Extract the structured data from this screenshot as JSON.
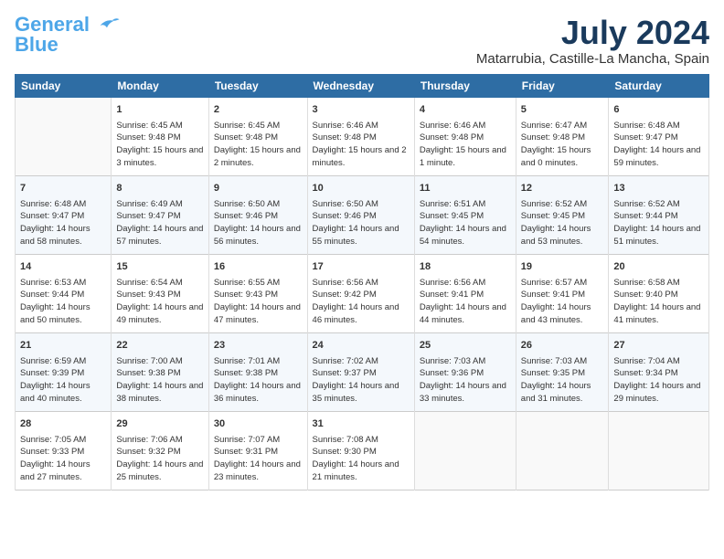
{
  "logo": {
    "line1": "General",
    "line2": "Blue"
  },
  "title": {
    "month_year": "July 2024",
    "location": "Matarrubia, Castille-La Mancha, Spain"
  },
  "days_of_week": [
    "Sunday",
    "Monday",
    "Tuesday",
    "Wednesday",
    "Thursday",
    "Friday",
    "Saturday"
  ],
  "weeks": [
    [
      {
        "day": "",
        "sunrise": "",
        "sunset": "",
        "daylight": ""
      },
      {
        "day": "1",
        "sunrise": "Sunrise: 6:45 AM",
        "sunset": "Sunset: 9:48 PM",
        "daylight": "Daylight: 15 hours and 3 minutes."
      },
      {
        "day": "2",
        "sunrise": "Sunrise: 6:45 AM",
        "sunset": "Sunset: 9:48 PM",
        "daylight": "Daylight: 15 hours and 2 minutes."
      },
      {
        "day": "3",
        "sunrise": "Sunrise: 6:46 AM",
        "sunset": "Sunset: 9:48 PM",
        "daylight": "Daylight: 15 hours and 2 minutes."
      },
      {
        "day": "4",
        "sunrise": "Sunrise: 6:46 AM",
        "sunset": "Sunset: 9:48 PM",
        "daylight": "Daylight: 15 hours and 1 minute."
      },
      {
        "day": "5",
        "sunrise": "Sunrise: 6:47 AM",
        "sunset": "Sunset: 9:48 PM",
        "daylight": "Daylight: 15 hours and 0 minutes."
      },
      {
        "day": "6",
        "sunrise": "Sunrise: 6:48 AM",
        "sunset": "Sunset: 9:47 PM",
        "daylight": "Daylight: 14 hours and 59 minutes."
      }
    ],
    [
      {
        "day": "7",
        "sunrise": "Sunrise: 6:48 AM",
        "sunset": "Sunset: 9:47 PM",
        "daylight": "Daylight: 14 hours and 58 minutes."
      },
      {
        "day": "8",
        "sunrise": "Sunrise: 6:49 AM",
        "sunset": "Sunset: 9:47 PM",
        "daylight": "Daylight: 14 hours and 57 minutes."
      },
      {
        "day": "9",
        "sunrise": "Sunrise: 6:50 AM",
        "sunset": "Sunset: 9:46 PM",
        "daylight": "Daylight: 14 hours and 56 minutes."
      },
      {
        "day": "10",
        "sunrise": "Sunrise: 6:50 AM",
        "sunset": "Sunset: 9:46 PM",
        "daylight": "Daylight: 14 hours and 55 minutes."
      },
      {
        "day": "11",
        "sunrise": "Sunrise: 6:51 AM",
        "sunset": "Sunset: 9:45 PM",
        "daylight": "Daylight: 14 hours and 54 minutes."
      },
      {
        "day": "12",
        "sunrise": "Sunrise: 6:52 AM",
        "sunset": "Sunset: 9:45 PM",
        "daylight": "Daylight: 14 hours and 53 minutes."
      },
      {
        "day": "13",
        "sunrise": "Sunrise: 6:52 AM",
        "sunset": "Sunset: 9:44 PM",
        "daylight": "Daylight: 14 hours and 51 minutes."
      }
    ],
    [
      {
        "day": "14",
        "sunrise": "Sunrise: 6:53 AM",
        "sunset": "Sunset: 9:44 PM",
        "daylight": "Daylight: 14 hours and 50 minutes."
      },
      {
        "day": "15",
        "sunrise": "Sunrise: 6:54 AM",
        "sunset": "Sunset: 9:43 PM",
        "daylight": "Daylight: 14 hours and 49 minutes."
      },
      {
        "day": "16",
        "sunrise": "Sunrise: 6:55 AM",
        "sunset": "Sunset: 9:43 PM",
        "daylight": "Daylight: 14 hours and 47 minutes."
      },
      {
        "day": "17",
        "sunrise": "Sunrise: 6:56 AM",
        "sunset": "Sunset: 9:42 PM",
        "daylight": "Daylight: 14 hours and 46 minutes."
      },
      {
        "day": "18",
        "sunrise": "Sunrise: 6:56 AM",
        "sunset": "Sunset: 9:41 PM",
        "daylight": "Daylight: 14 hours and 44 minutes."
      },
      {
        "day": "19",
        "sunrise": "Sunrise: 6:57 AM",
        "sunset": "Sunset: 9:41 PM",
        "daylight": "Daylight: 14 hours and 43 minutes."
      },
      {
        "day": "20",
        "sunrise": "Sunrise: 6:58 AM",
        "sunset": "Sunset: 9:40 PM",
        "daylight": "Daylight: 14 hours and 41 minutes."
      }
    ],
    [
      {
        "day": "21",
        "sunrise": "Sunrise: 6:59 AM",
        "sunset": "Sunset: 9:39 PM",
        "daylight": "Daylight: 14 hours and 40 minutes."
      },
      {
        "day": "22",
        "sunrise": "Sunrise: 7:00 AM",
        "sunset": "Sunset: 9:38 PM",
        "daylight": "Daylight: 14 hours and 38 minutes."
      },
      {
        "day": "23",
        "sunrise": "Sunrise: 7:01 AM",
        "sunset": "Sunset: 9:38 PM",
        "daylight": "Daylight: 14 hours and 36 minutes."
      },
      {
        "day": "24",
        "sunrise": "Sunrise: 7:02 AM",
        "sunset": "Sunset: 9:37 PM",
        "daylight": "Daylight: 14 hours and 35 minutes."
      },
      {
        "day": "25",
        "sunrise": "Sunrise: 7:03 AM",
        "sunset": "Sunset: 9:36 PM",
        "daylight": "Daylight: 14 hours and 33 minutes."
      },
      {
        "day": "26",
        "sunrise": "Sunrise: 7:03 AM",
        "sunset": "Sunset: 9:35 PM",
        "daylight": "Daylight: 14 hours and 31 minutes."
      },
      {
        "day": "27",
        "sunrise": "Sunrise: 7:04 AM",
        "sunset": "Sunset: 9:34 PM",
        "daylight": "Daylight: 14 hours and 29 minutes."
      }
    ],
    [
      {
        "day": "28",
        "sunrise": "Sunrise: 7:05 AM",
        "sunset": "Sunset: 9:33 PM",
        "daylight": "Daylight: 14 hours and 27 minutes."
      },
      {
        "day": "29",
        "sunrise": "Sunrise: 7:06 AM",
        "sunset": "Sunset: 9:32 PM",
        "daylight": "Daylight: 14 hours and 25 minutes."
      },
      {
        "day": "30",
        "sunrise": "Sunrise: 7:07 AM",
        "sunset": "Sunset: 9:31 PM",
        "daylight": "Daylight: 14 hours and 23 minutes."
      },
      {
        "day": "31",
        "sunrise": "Sunrise: 7:08 AM",
        "sunset": "Sunset: 9:30 PM",
        "daylight": "Daylight: 14 hours and 21 minutes."
      },
      {
        "day": "",
        "sunrise": "",
        "sunset": "",
        "daylight": ""
      },
      {
        "day": "",
        "sunrise": "",
        "sunset": "",
        "daylight": ""
      },
      {
        "day": "",
        "sunrise": "",
        "sunset": "",
        "daylight": ""
      }
    ]
  ]
}
